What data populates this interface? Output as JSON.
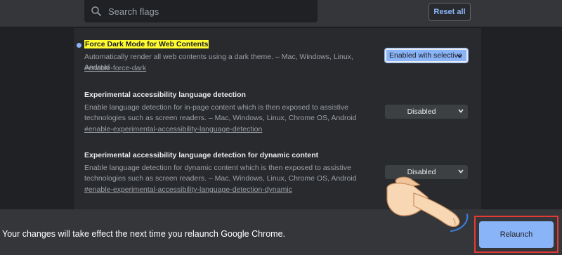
{
  "search": {
    "placeholder": "Search flags"
  },
  "header": {
    "reset_label": "Reset all"
  },
  "flags": [
    {
      "title": "Force Dark Mode for Web Contents",
      "description": "Automatically render all web contents using a dark theme. – Mac, Windows, Linux, Android",
      "link": "#enable-force-dark",
      "selected": "Enabled with selective"
    },
    {
      "title": "Experimental accessibility language detection",
      "description": "Enable language detection for in-page content which is then exposed to assistive technologies such as screen readers. – Mac, Windows, Linux, Chrome OS, Android",
      "link": "#enable-experimental-accessibility-language-detection",
      "selected": "Disabled"
    },
    {
      "title": "Experimental accessibility language detection for dynamic content",
      "description": "Enable language detection for dynamic content which is then exposed to assistive technologies such as screen readers. – Mac, Windows, Linux, Chrome OS, Android",
      "link": "#enable-experimental-accessibility-language-detection-dynamic",
      "selected": "Disabled"
    }
  ],
  "footer": {
    "message": "Your changes will take effect the next time you relaunch Google Chrome.",
    "relaunch_label": "Relaunch"
  },
  "colors": {
    "accent": "#8ab4f8",
    "highlight": "#fffc32",
    "frame": "#e53935"
  }
}
